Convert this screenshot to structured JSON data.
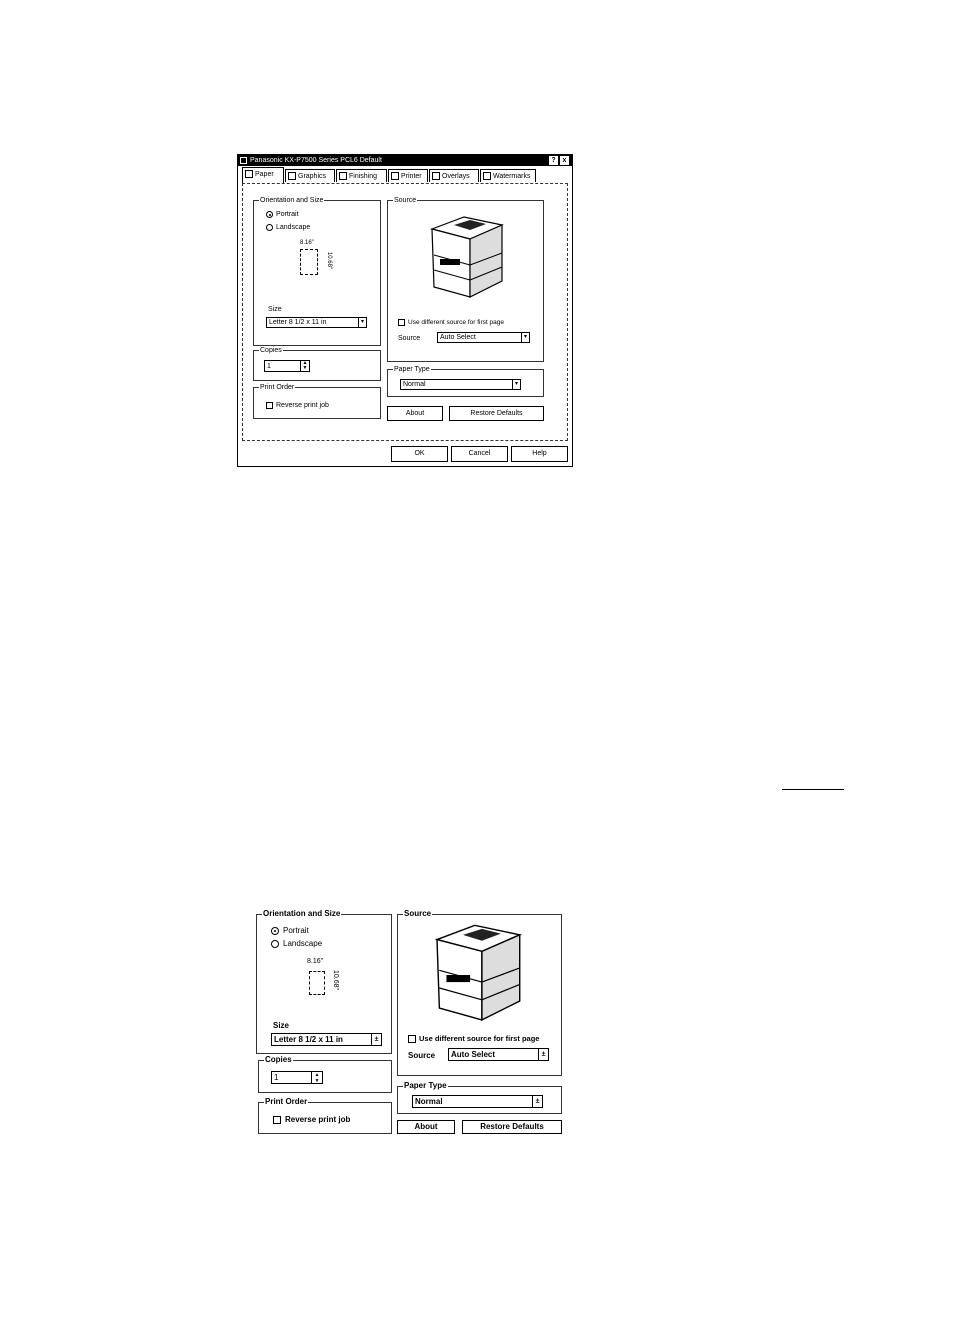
{
  "dialog": {
    "title": "Panasonic KX-P7500 Series PCL6 Default",
    "title_buttons": [
      "?",
      "x"
    ],
    "tabs": [
      "Paper",
      "Graphics",
      "Finishing",
      "Printer",
      "Overlays",
      "Watermarks"
    ],
    "active_tab": "Paper",
    "orientation": {
      "group_title": "Orientation and Size",
      "portrait": "Portrait",
      "landscape": "Landscape",
      "selected": "Portrait",
      "width_label": "8.16\"",
      "height_label": "10.68\"",
      "size_label": "Size",
      "size_value": "Letter 8 1/2 x 11 in"
    },
    "copies": {
      "group_title": "Copies",
      "value": "1"
    },
    "print_order": {
      "group_title": "Print Order",
      "reverse_label": "Reverse print job",
      "reverse_checked": false
    },
    "source": {
      "group_title": "Source",
      "diff_source_label": "Use different source for first page",
      "diff_source_checked": false,
      "source_label": "Source",
      "source_value": "Auto Select"
    },
    "paper_type": {
      "group_title": "Paper Type",
      "value": "Normal"
    },
    "about_button": "About",
    "restore_button": "Restore Defaults",
    "ok_button": "OK",
    "cancel_button": "Cancel",
    "help_button": "Help"
  },
  "zoom": {
    "orientation_title": "Orientation and Size",
    "portrait": "Portrait",
    "landscape": "Landscape",
    "width_label": "8.16\"",
    "height_label": "10.68\"",
    "size_label": "Size",
    "size_value": "Letter 8 1/2 x 11 in",
    "copies_title": "Copies",
    "copies_value": "1",
    "print_order_title": "Print Order",
    "reverse_label": "Reverse print job",
    "source_title": "Source",
    "diff_source_label": "Use different source for first page",
    "source_label": "Source",
    "source_value": "Auto Select",
    "paper_type_title": "Paper Type",
    "paper_type_value": "Normal",
    "about_button": "About",
    "restore_button": "Restore Defaults"
  }
}
